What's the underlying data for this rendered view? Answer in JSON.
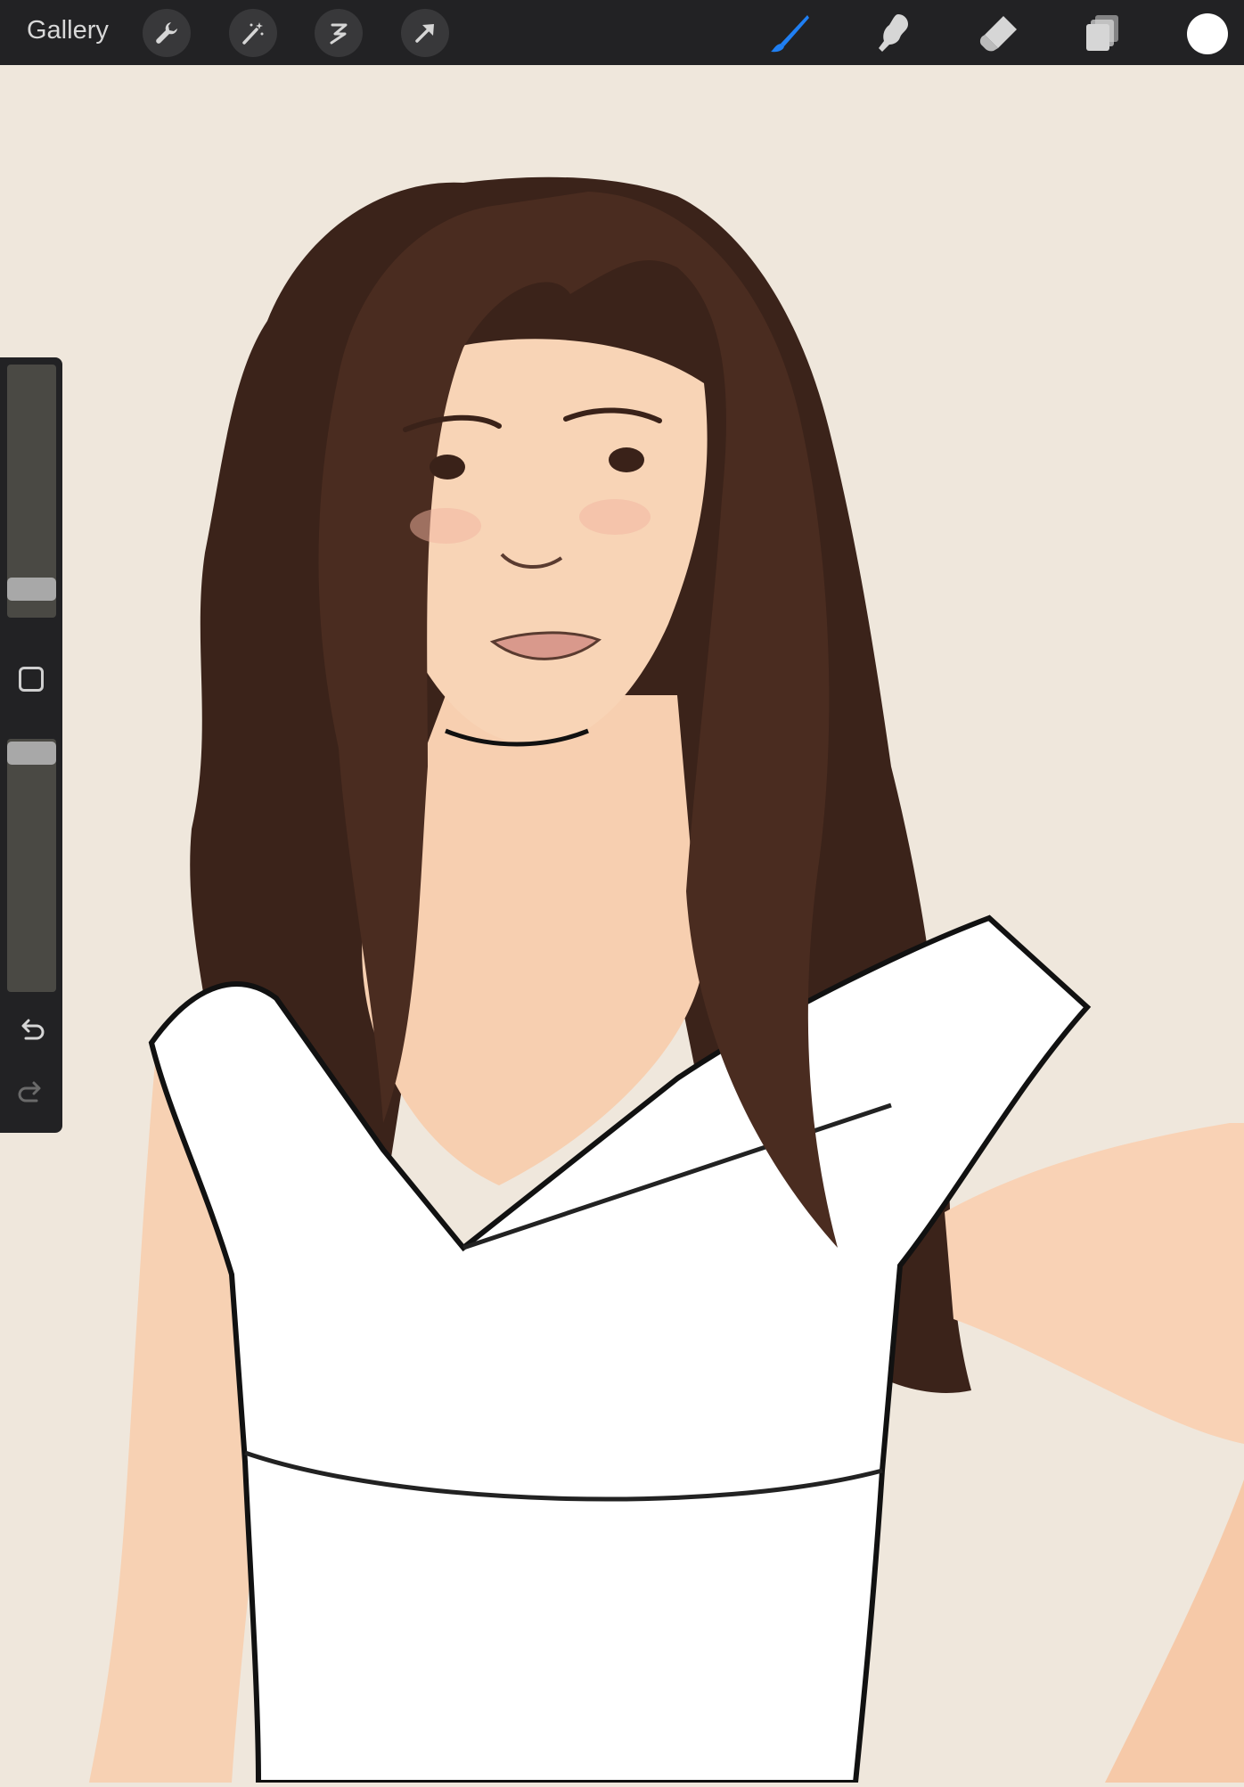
{
  "app": {
    "gallery_label": "Gallery"
  },
  "toolbar": {
    "left_icons": [
      "wrench-icon",
      "magic-wand-icon",
      "selection-icon",
      "transform-arrow-icon"
    ],
    "right_tools": [
      "brush-icon",
      "smudge-icon",
      "eraser-icon",
      "layers-icon"
    ],
    "active_tool": "brush",
    "accent_color": "#1f7ff3",
    "current_color": "#ffffff"
  },
  "sidebar": {
    "brush_size_level": 0.08,
    "brush_opacity_level": 0.98,
    "controls": [
      "brush-size-slider",
      "modify-button",
      "opacity-slider",
      "undo-icon",
      "redo-icon"
    ]
  },
  "canvas": {
    "background_color": "#efe7dc",
    "content": "illustration"
  }
}
